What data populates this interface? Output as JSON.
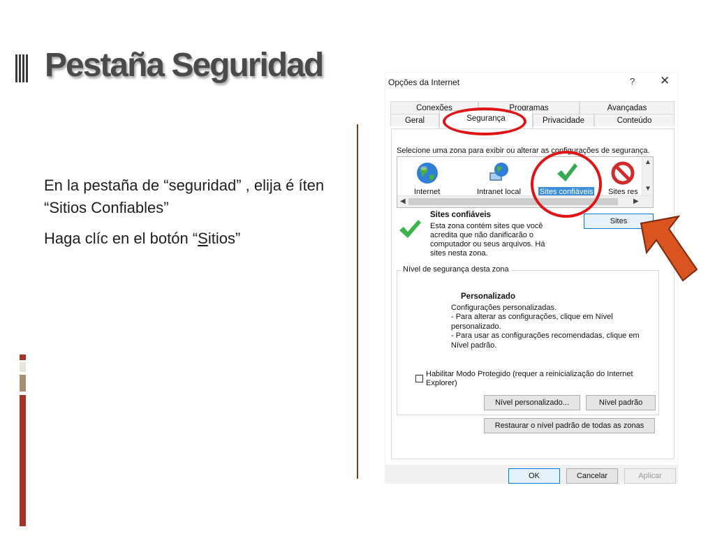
{
  "slide": {
    "title": "Pestaña Seguridad",
    "bullets": {
      "line1": "En la pestaña de “seguridad” , elija é íten “Sitios Confiables”",
      "line2_before": "Haga clíc en el botón “",
      "line2_underlined": "S",
      "line2_after": "itios”"
    }
  },
  "dialog": {
    "title": "Opções da Internet",
    "help": "?",
    "close": "✕",
    "tabs_back": [
      "Conexões",
      "Programas",
      "Avançadas"
    ],
    "tabs_front": [
      "Geral",
      "Segurança",
      "Privacidade",
      "Conteúdo"
    ],
    "active_tab": "Segurança",
    "zone_prompt": "Selecione uma zona para exibir ou alterar as configurações de segurança.",
    "zones": [
      {
        "label": "Internet",
        "icon": "globe-icon"
      },
      {
        "label": "Intranet local",
        "icon": "intranet-globe-icon"
      },
      {
        "label": "Sites confiáveis",
        "icon": "checkmark-icon",
        "selected": true
      },
      {
        "label": "Sites res",
        "icon": "restricted-icon"
      }
    ],
    "zone_info": {
      "name": "Sites confiáveis",
      "description": "Esta zona contém sites que você acredita que não danificarão o computador ou seus arquivos. Há sites nesta zona.",
      "sites_button": "Sites"
    },
    "security_level": {
      "group_label": "Nível de segurança desta zona",
      "level_name": "Personalizado",
      "level_desc_lines": [
        "Configurações personalizadas.",
        "- Para alterar as configurações, clique em Nível",
        "personalizado.",
        "- Para usar as configurações recomendadas, clique em",
        "Nível padrão."
      ],
      "protected_mode_label": "Habilitar Modo Protegido (requer a reinicialização do Internet Explorer)",
      "protected_mode_checked": false,
      "custom_level_button": "Nível personalizado...",
      "default_level_button": "Nível padrão"
    },
    "reset_all_button": "Restaurar o nível padrão de todas as zonas",
    "ok_button": "OK",
    "cancel_button": "Cancelar",
    "apply_button": "Aplicar"
  },
  "colors": {
    "highlight_ring": "#e01414",
    "arrow_fill": "#d9541e",
    "selection_blue": "#3b8edb",
    "divider": "#8b3a22"
  }
}
